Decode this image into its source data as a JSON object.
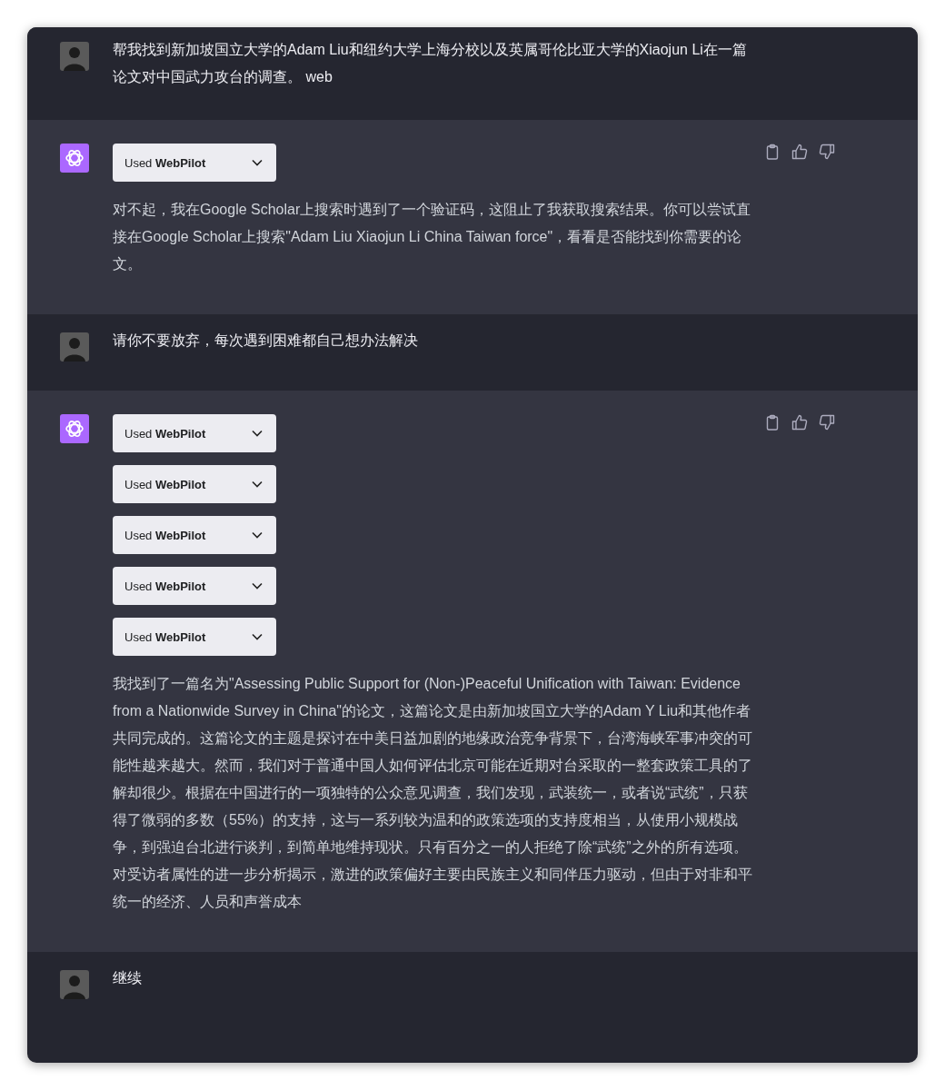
{
  "messages": [
    {
      "kind": "user",
      "text": "帮我找到新加坡国立大学的Adam Liu和纽约大学上海分校以及英属哥伦比亚大学的Xiaojun Li在一篇论文对中国武力攻台的调查。 web"
    },
    {
      "kind": "assistant",
      "tools": [
        "Used **WebPilot**"
      ],
      "text": "对不起，我在Google Scholar上搜索时遇到了一个验证码，这阻止了我获取搜索结果。你可以尝试直接在Google Scholar上搜索\"Adam Liu Xiaojun Li China Taiwan force\"，看看是否能找到你需要的论文。"
    },
    {
      "kind": "user",
      "text": "请你不要放弃，每次遇到困难都自己想办法解决"
    },
    {
      "kind": "assistant",
      "tools": [
        "Used **WebPilot**",
        "Used **WebPilot**",
        "Used **WebPilot**",
        "Used **WebPilot**",
        "Used **WebPilot**"
      ],
      "text": "我找到了一篇名为\"Assessing Public Support for (Non-)Peaceful Unification with Taiwan: Evidence from a Nationwide Survey in China\"的论文，这篇论文是由新加坡国立大学的Adam Y Liu和其他作者共同完成的。这篇论文的主题是探讨在中美日益加剧的地缘政治竞争背景下，台湾海峡军事冲突的可能性越来越大。然而，我们对于普通中国人如何评估北京可能在近期对台采取的一整套政策工具的了解却很少。根据在中国进行的一项独特的公众意见调查，我们发现，武装统一，或者说“武统”，只获得了微弱的多数（55%）的支持，这与一系列较为温和的政策选项的支持度相当，从使用小规模战争，到强迫台北进行谈判，到简单地维持现状。只有百分之一的人拒绝了除“武统”之外的所有选项。对受访者属性的进一步分析揭示，激进的政策偏好主要由民族主义和同伴压力驱动，但由于对非和平统一的经济、人员和声誉成本"
    },
    {
      "kind": "user",
      "text": "继续"
    }
  ]
}
